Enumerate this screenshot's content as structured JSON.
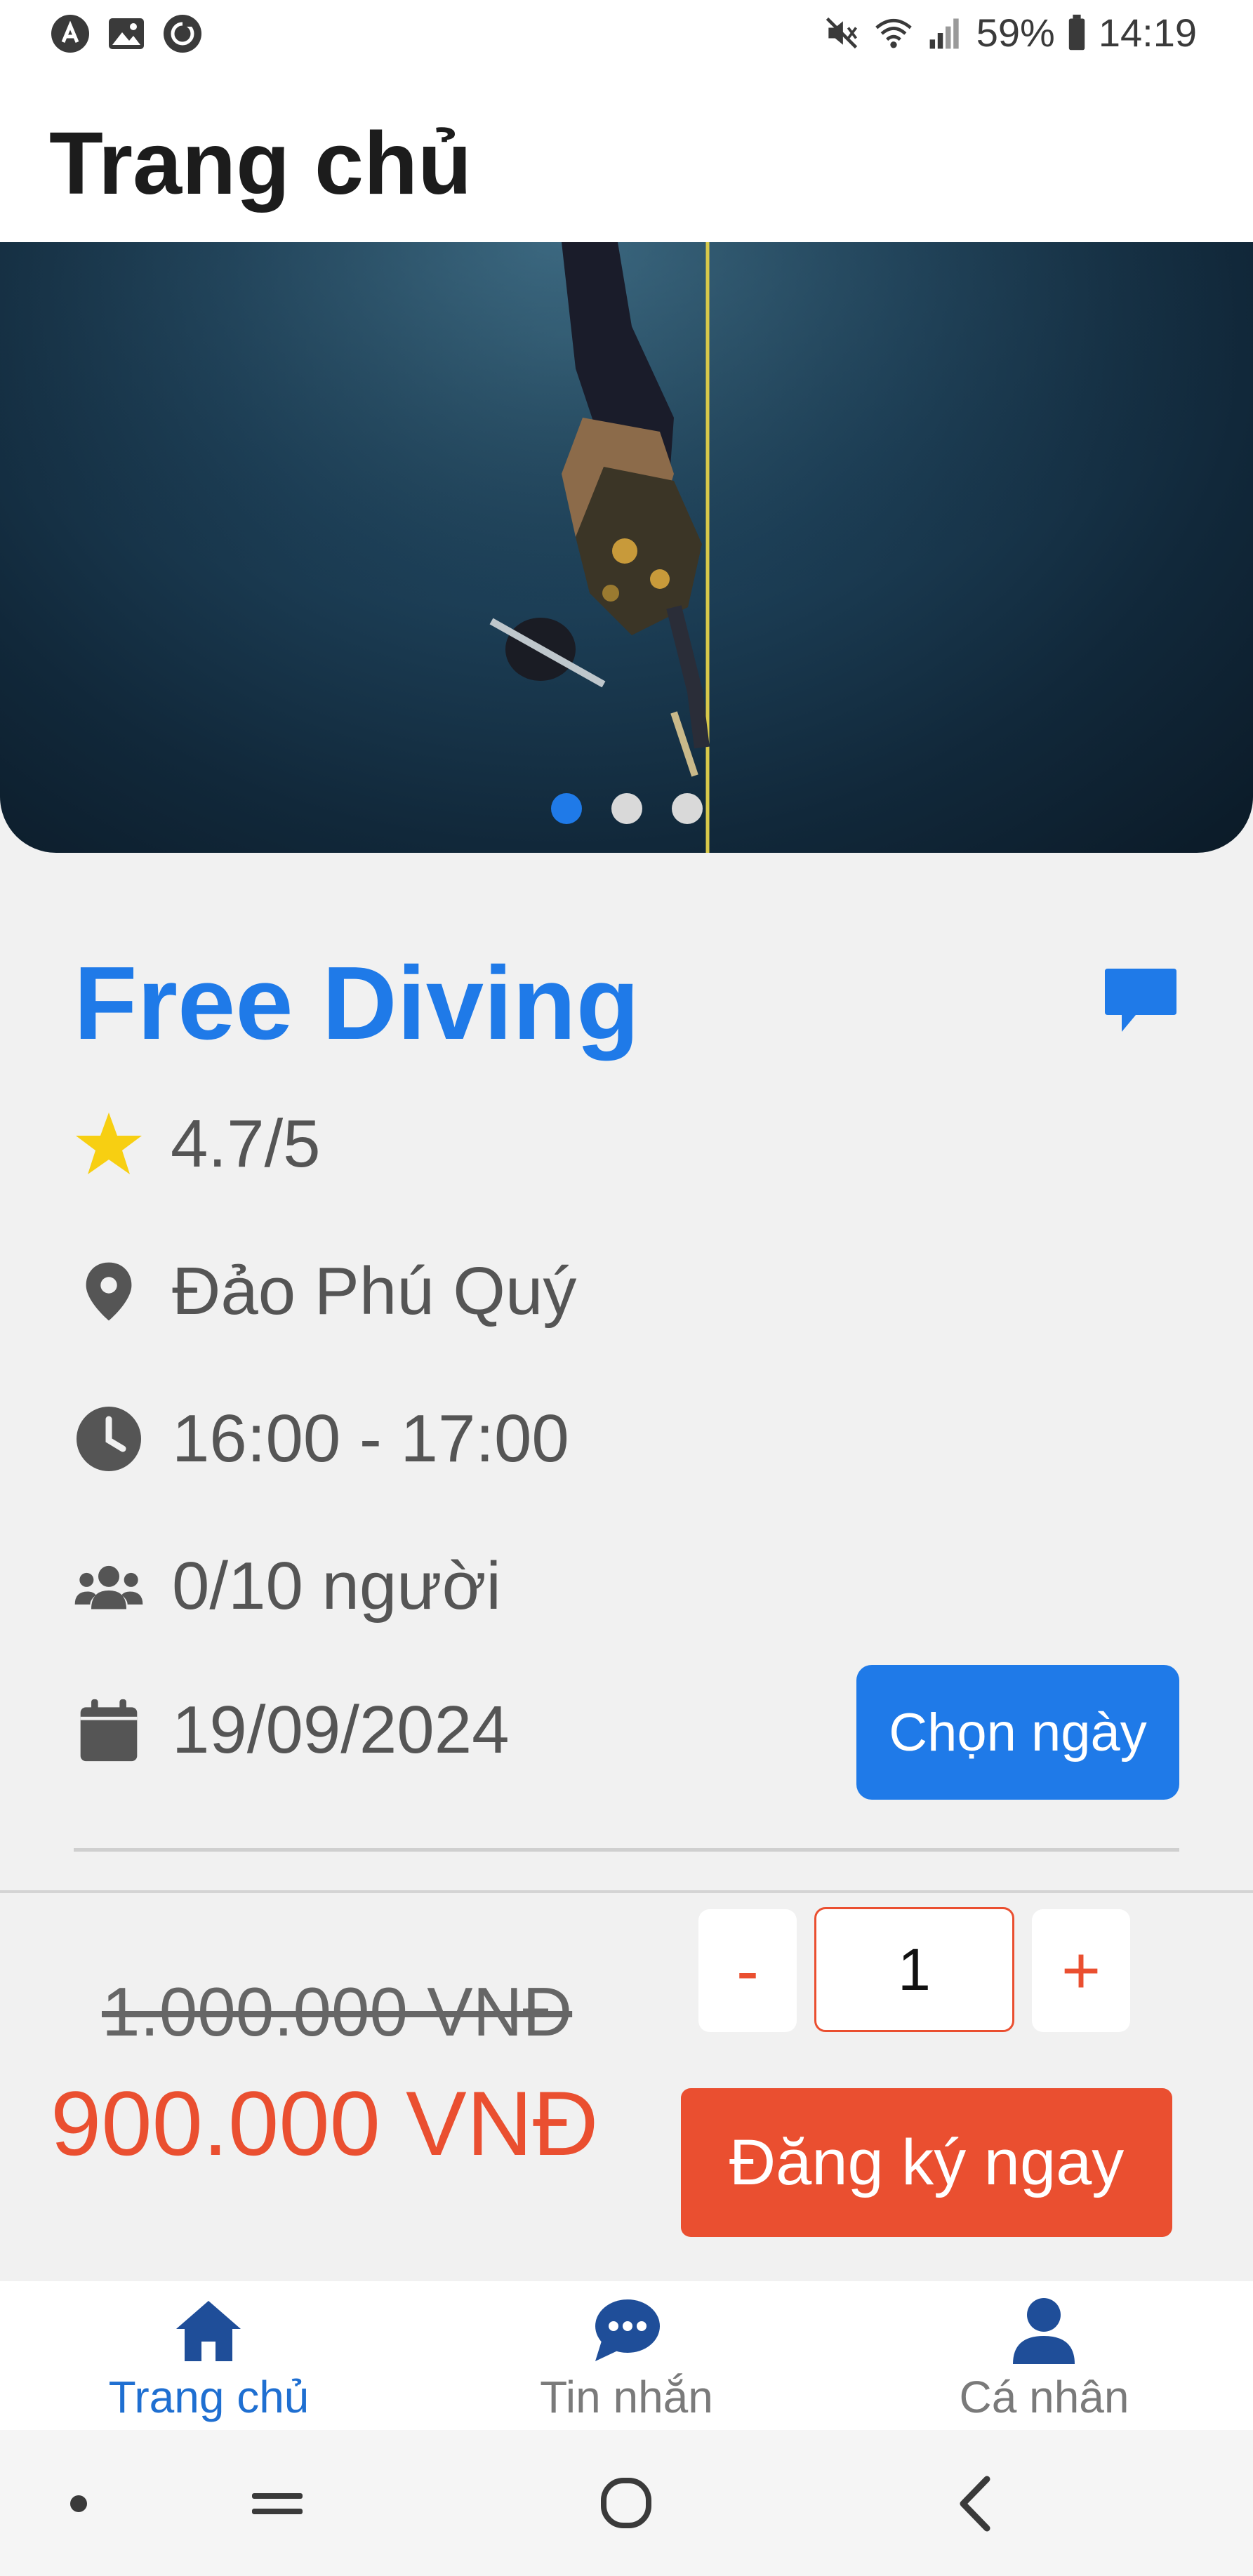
{
  "status_bar": {
    "battery": "59%",
    "time": "14:19",
    "left_icons": [
      "app-notification-icon",
      "image-icon",
      "sync-app-icon"
    ],
    "right_icons": [
      "mute-icon",
      "wifi-icon",
      "signal-icon",
      "battery-icon"
    ]
  },
  "header": {
    "title": "Trang chủ"
  },
  "carousel": {
    "slide_count": 3,
    "active_index": 0
  },
  "activity": {
    "title": "Free Diving",
    "rating": "4.7/5",
    "location": "Đảo Phú Quý",
    "time": "16:00 - 17:00",
    "capacity": "0/10 người",
    "date": "19/09/2024",
    "choose_date_label": "Chọn ngày"
  },
  "booking": {
    "original_price": "1.000.000 VNĐ",
    "sale_price": "900.000 VNĐ",
    "decrement_label": "-",
    "increment_label": "+",
    "quantity": "1",
    "register_label": "Đăng ký ngay"
  },
  "bottom_nav": {
    "items": [
      {
        "label": "Trang chủ",
        "icon": "home-icon",
        "active": true
      },
      {
        "label": "Tin nhắn",
        "icon": "chat-icon",
        "active": false
      },
      {
        "label": "Cá nhân",
        "icon": "person-icon",
        "active": false
      }
    ]
  },
  "colors": {
    "primary_blue": "#1f7ae8",
    "accent_orange": "#ea4f30",
    "star_yellow": "#f7cf12",
    "background": "#f1f1f1"
  }
}
